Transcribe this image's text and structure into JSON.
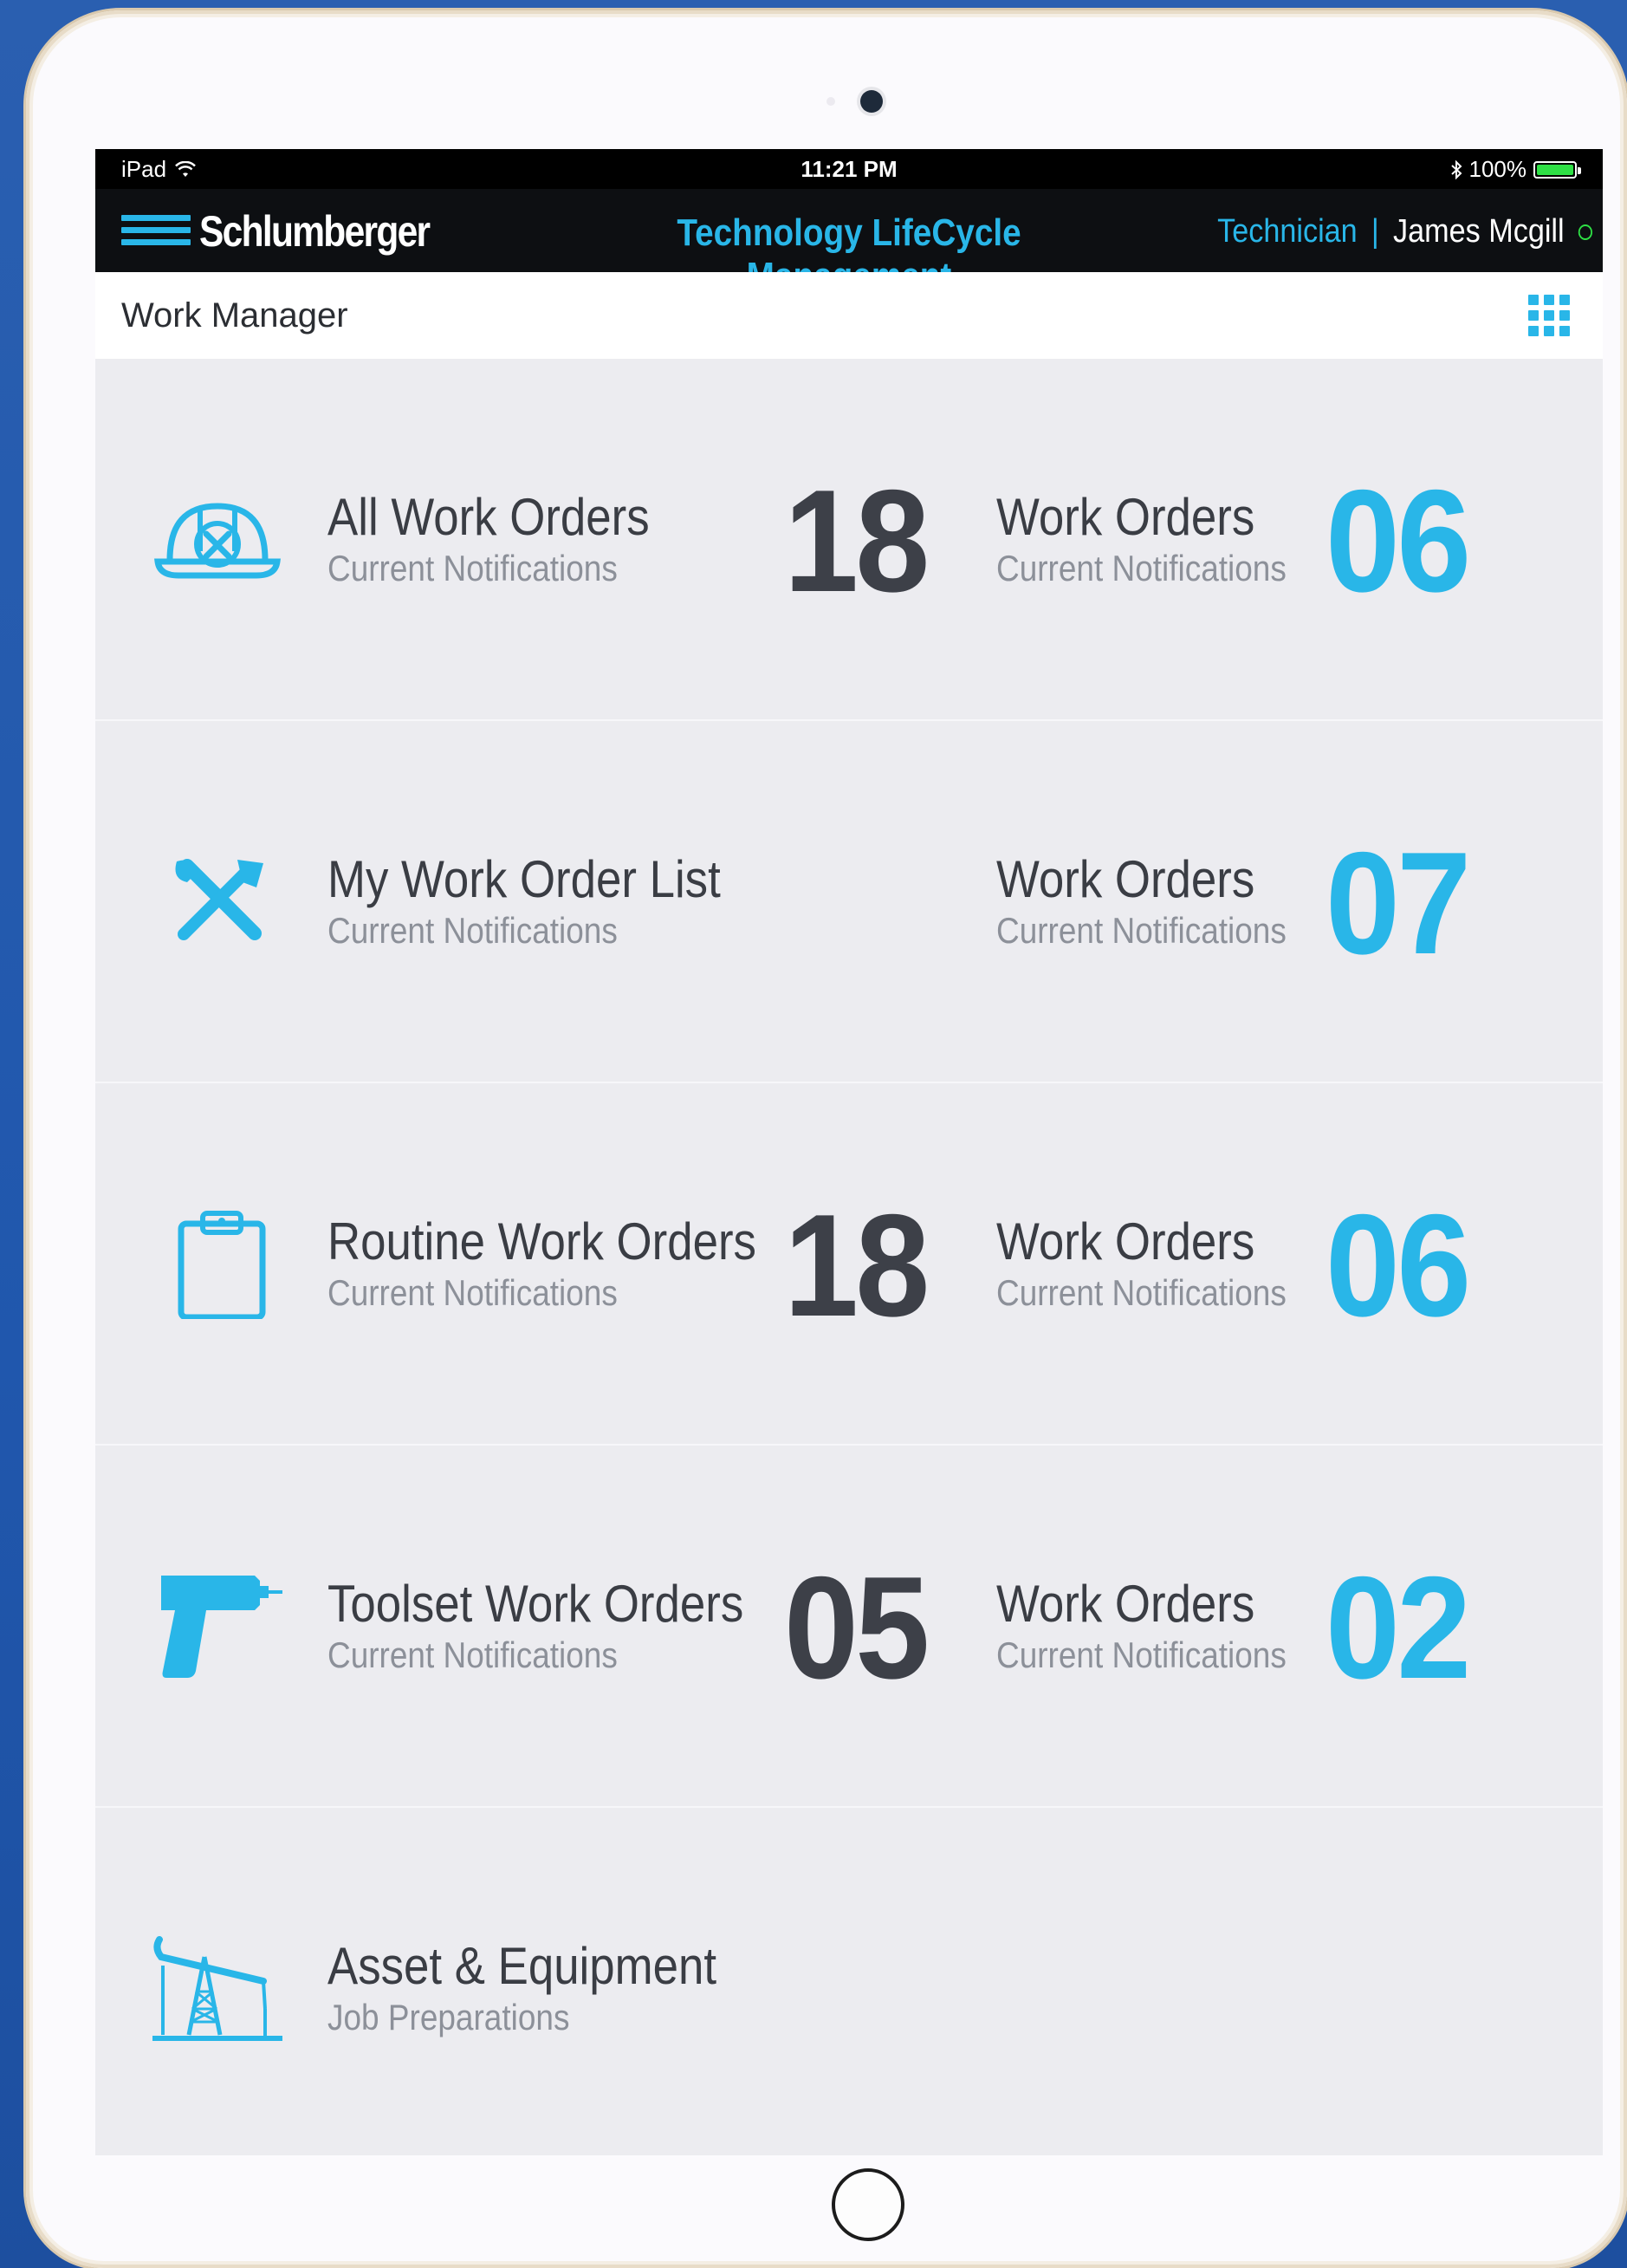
{
  "status_bar": {
    "device": "iPad",
    "time": "11:21 PM",
    "battery": "100%"
  },
  "header": {
    "brand": "Schlumberger",
    "app_title": "Technology LifeCycle Management",
    "role": "Technician",
    "separator": "|",
    "user_name": "James Mcgill"
  },
  "sub_header": {
    "title": "Work Manager"
  },
  "rows": [
    {
      "icon": "hard-hat-icon",
      "title": "All Work Orders",
      "subtitle": "Current Notifications",
      "count": "18",
      "wo_title": "Work Orders",
      "wo_subtitle": "Current Notifications",
      "wo_count": "06"
    },
    {
      "icon": "wrench-hammer-icon",
      "title": "My Work Order List",
      "subtitle": "Current Notifications",
      "count": "",
      "wo_title": "Work Orders",
      "wo_subtitle": "Current Notifications",
      "wo_count": "07"
    },
    {
      "icon": "clipboard-icon",
      "title": "Routine Work Orders",
      "subtitle": "Current Notifications",
      "count": "18",
      "wo_title": "Work Orders",
      "wo_subtitle": "Current Notifications",
      "wo_count": "06"
    },
    {
      "icon": "drill-icon",
      "title": "Toolset Work Orders",
      "subtitle": "Current Notifications",
      "count": "05",
      "wo_title": "Work Orders",
      "wo_subtitle": "Current Notifications",
      "wo_count": "02"
    },
    {
      "icon": "oil-pump-icon",
      "title": "Asset & Equipment",
      "subtitle": "Job Preparations"
    }
  ],
  "colors": {
    "accent": "#29b6e8",
    "header_bg": "#0d0f12",
    "list_bg": "#ececf0",
    "count_dark": "#3d4048"
  }
}
